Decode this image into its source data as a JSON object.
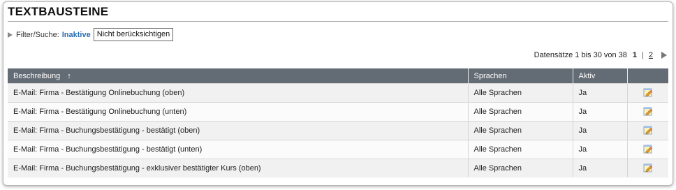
{
  "page": {
    "title": "TEXTBAUSTEINE"
  },
  "filter": {
    "label": "Filter/Suche:",
    "value": "Inaktive",
    "button_label": "Nicht berücksichtigen"
  },
  "pager": {
    "records_text": "Datensätze 1 bis 30 von 38",
    "current_page": "1",
    "separator": "|",
    "page2": "2"
  },
  "table": {
    "headers": {
      "beschreibung": "Beschreibung",
      "sort_indicator": "↑",
      "sprachen": "Sprachen",
      "aktiv": "Aktiv"
    },
    "rows": [
      {
        "beschreibung": "E-Mail: Firma - Bestätigung Onlinebuchung (oben)",
        "sprachen": "Alle Sprachen",
        "aktiv": "Ja"
      },
      {
        "beschreibung": "E-Mail: Firma - Bestätigung Onlinebuchung (unten)",
        "sprachen": "Alle Sprachen",
        "aktiv": "Ja"
      },
      {
        "beschreibung": "E-Mail: Firma - Buchungsbestätigung - bestätigt (oben)",
        "sprachen": "Alle Sprachen",
        "aktiv": "Ja"
      },
      {
        "beschreibung": "E-Mail: Firma - Buchungsbestätigung - bestätigt (unten)",
        "sprachen": "Alle Sprachen",
        "aktiv": "Ja"
      },
      {
        "beschreibung": "E-Mail: Firma - Buchungsbestätigung - exklusiver bestätigter Kurs (oben)",
        "sprachen": "Alle Sprachen",
        "aktiv": "Ja"
      }
    ],
    "row_icon": "edit-icon"
  },
  "colors": {
    "header_bg": "#636c74",
    "link_blue": "#2a6fb3",
    "row_odd": "#f1f1f1",
    "row_even": "#fbfbfb"
  }
}
